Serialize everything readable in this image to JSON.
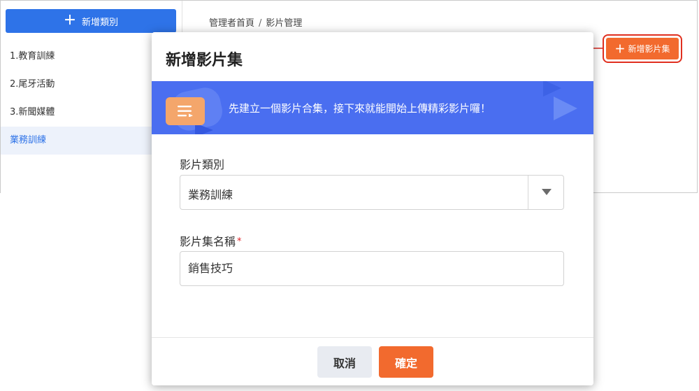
{
  "sidebar": {
    "add_category_label": "新增類別",
    "categories": [
      {
        "label": "1.教育訓練"
      },
      {
        "label": "2.尾牙活動"
      },
      {
        "label": "3.新聞媒體"
      },
      {
        "label": "業務訓練"
      }
    ],
    "active_index": 3
  },
  "breadcrumb": {
    "home": "管理者首頁",
    "separator": "/",
    "current": "影片管理"
  },
  "header": {
    "add_album_label": "新增影片集"
  },
  "modal": {
    "title": "新增影片集",
    "banner_text": "先建立一個影片合集，接下來就能開始上傳精彩影片囉！",
    "category_field": {
      "label": "影片類別",
      "selected": "業務訓練"
    },
    "name_field": {
      "label": "影片集名稱",
      "required_mark": "*",
      "value": "銷售技巧"
    },
    "cancel_label": "取消",
    "confirm_label": "確定"
  },
  "colors": {
    "primary_blue": "#2e73e8",
    "accent_orange": "#f26a2e",
    "banner_blue": "#4a6ef0",
    "highlight_red": "#e03020"
  },
  "icons": {
    "banner": "list-icon",
    "add": "plus-icon",
    "select": "chevron-down-icon"
  }
}
